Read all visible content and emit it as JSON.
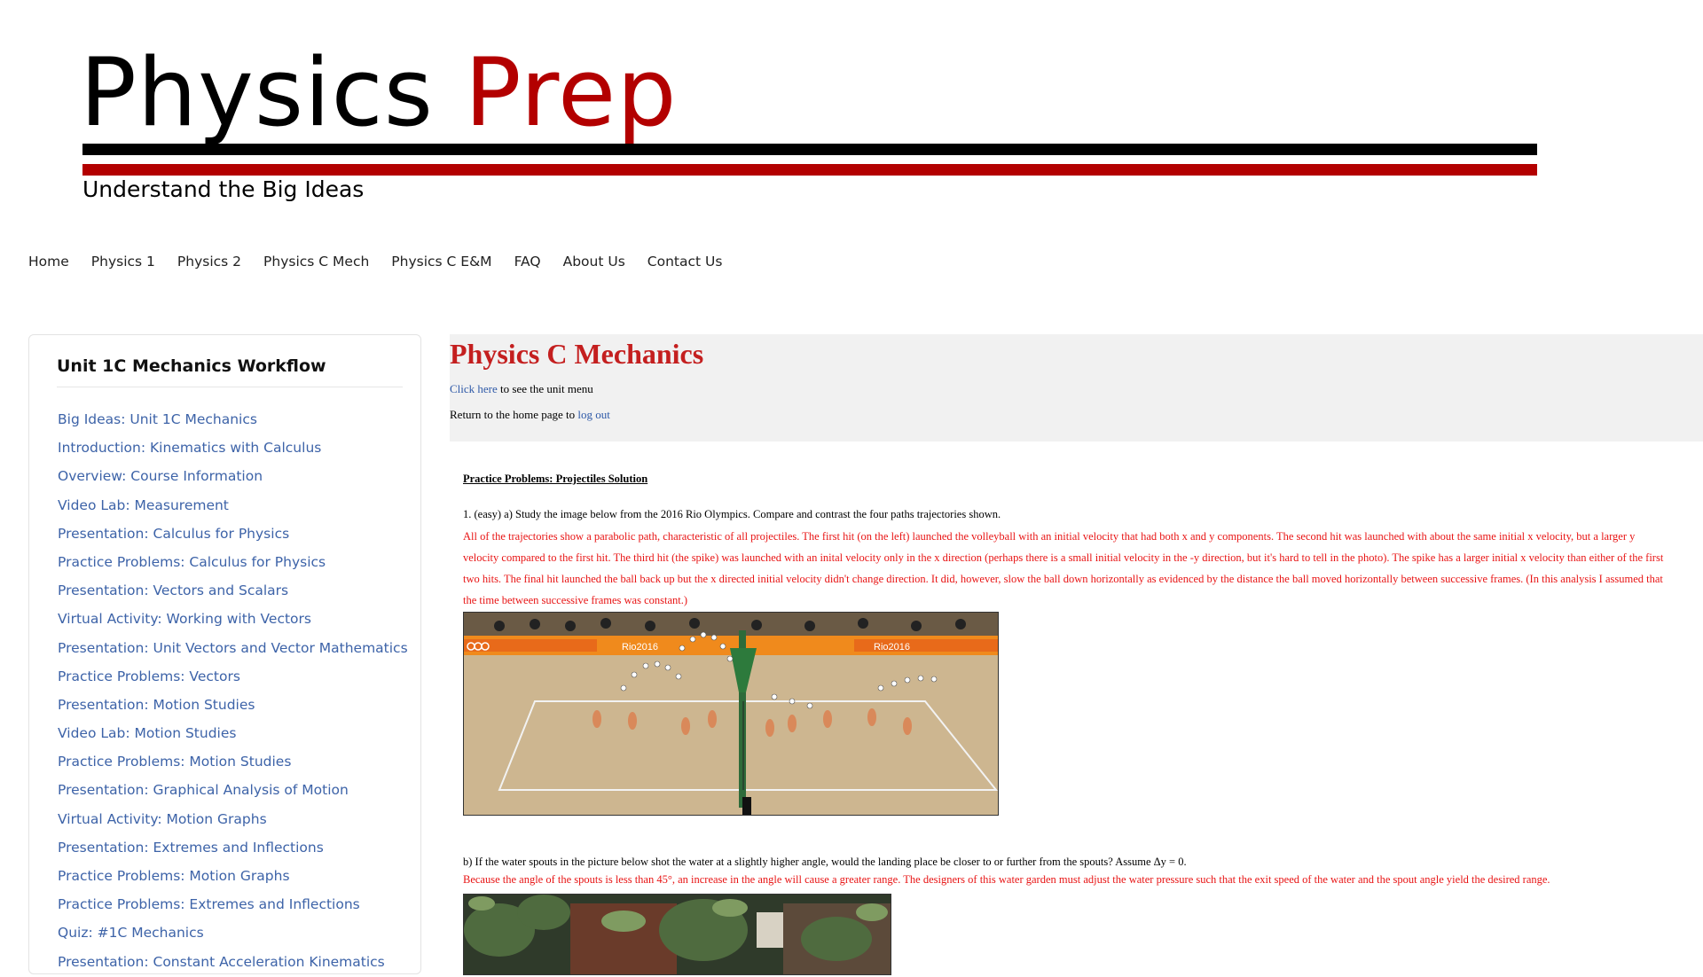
{
  "logo": {
    "word1": "Physics",
    "word2": "Prep",
    "tagline": "Understand the Big Ideas",
    "colors": {
      "black": "#000000",
      "red": "#b30000"
    }
  },
  "nav": {
    "items": [
      "Home",
      "Physics 1",
      "Physics 2",
      "Physics C Mech",
      "Physics C E&M",
      "FAQ",
      "About Us",
      "Contact Us"
    ]
  },
  "sidebar": {
    "title": "Unit 1C Mechanics Workflow",
    "items": [
      "Big Ideas: Unit 1C Mechanics",
      "Introduction: Kinematics with Calculus",
      "Overview: Course Information",
      "Video Lab: Measurement",
      "Presentation: Calculus for Physics",
      "Practice Problems: Calculus for Physics",
      "Presentation: Vectors and Scalars",
      "Virtual Activity: Working with Vectors",
      "Presentation: Unit Vectors and Vector Mathematics",
      "Practice Problems: Vectors",
      "Presentation: Motion Studies",
      "Video Lab: Motion Studies",
      "Practice Problems: Motion Studies",
      "Presentation: Graphical Analysis of Motion",
      "Virtual Activity: Motion Graphs",
      "Presentation: Extremes and Inflections",
      "Practice Problems: Motion Graphs",
      "Practice Problems: Extremes and Inflections",
      "Quiz: #1C Mechanics",
      "Presentation: Constant Acceleration Kinematics"
    ]
  },
  "header": {
    "title": "Physics C Mechanics",
    "unit_menu_link": "Click here",
    "unit_menu_text": " to see the unit menu",
    "return_text": "Return to the home page to ",
    "logout_link": "log out"
  },
  "content": {
    "section_title": "Practice Problems: Projectiles Solution",
    "q1a": "1. (easy) a) Study the image below from the 2016 Rio Olympics. Compare and contrast the four paths trajectories shown.",
    "a1a": "All of the trajectories show a parabolic path, characteristic of all projectiles. The first hit (on the left) launched the volleyball with an initial velocity that had both x and y components. The second hit was launched with about the same initial x velocity, but a larger y velocity compared to the first hit. The third hit (the spike) was launched with an inital velocity only in the x direction (perhaps there is a small initial velocity in the -y direction, but it's hard to tell in the photo). The spike has a larger initial x velocity than either of the first two hits. The final hit launched the ball back up but the x directed initial velocity didn't change direction. It did, however, slow the ball down horizontally as evidenced by the distance the ball moved horizontally between successive frames. (In this analysis I assumed that the time between successive frames was constant.)",
    "photo1_banner_1": "Rio2016",
    "photo1_banner_2": "Rio2016",
    "q1b": "b) If the water spouts in the picture below shot the water at a slightly higher angle, would the landing place be closer to or further from the spouts? Assume Δy = 0.",
    "a1b": "Because the angle of the spouts is less than 45°, an increase in the angle will cause a greater range. The designers of this water garden must adjust the water pressure such that the exit speed of the water and the spout angle yield the desired range."
  }
}
